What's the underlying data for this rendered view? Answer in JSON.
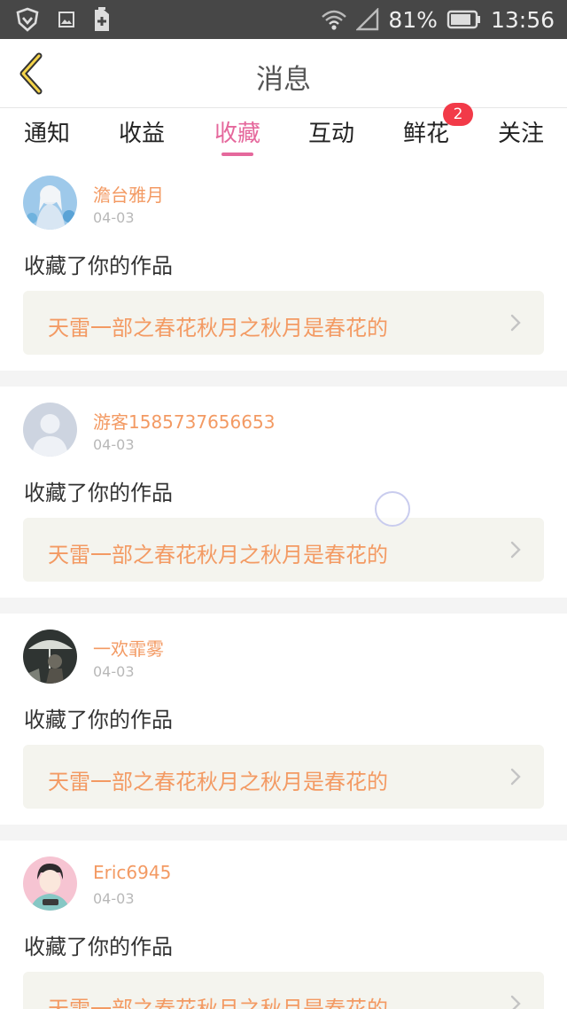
{
  "statusbar": {
    "battery_percent": "81%",
    "time": "13:56"
  },
  "header": {
    "title": "消息"
  },
  "tabs": [
    {
      "label": "通知"
    },
    {
      "label": "收益"
    },
    {
      "label": "收藏",
      "active": true
    },
    {
      "label": "互动"
    },
    {
      "label": "鲜花",
      "badge": "2"
    },
    {
      "label": "关注"
    }
  ],
  "items": [
    {
      "user": "澹台雅月",
      "date": "04-03",
      "action": "收藏了你的作品",
      "work_title": "天雷一部之春花秋月之秋月是春花的"
    },
    {
      "user": "游客1585737656653",
      "date": "04-03",
      "action": "收藏了你的作品",
      "work_title": "天雷一部之春花秋月之秋月是春花的"
    },
    {
      "user": "一欢霏雾",
      "date": "04-03",
      "action": "收藏了你的作品",
      "work_title": "天雷一部之春花秋月之秋月是春花的"
    },
    {
      "user": "Eric6945",
      "date": "04-03",
      "action": "收藏了你的作品",
      "work_title": "天雷一部之春花秋月之秋月是春花的"
    }
  ],
  "colors": {
    "accent": "#e5689c",
    "name": "#f39a63",
    "badge": "#f23a48"
  }
}
